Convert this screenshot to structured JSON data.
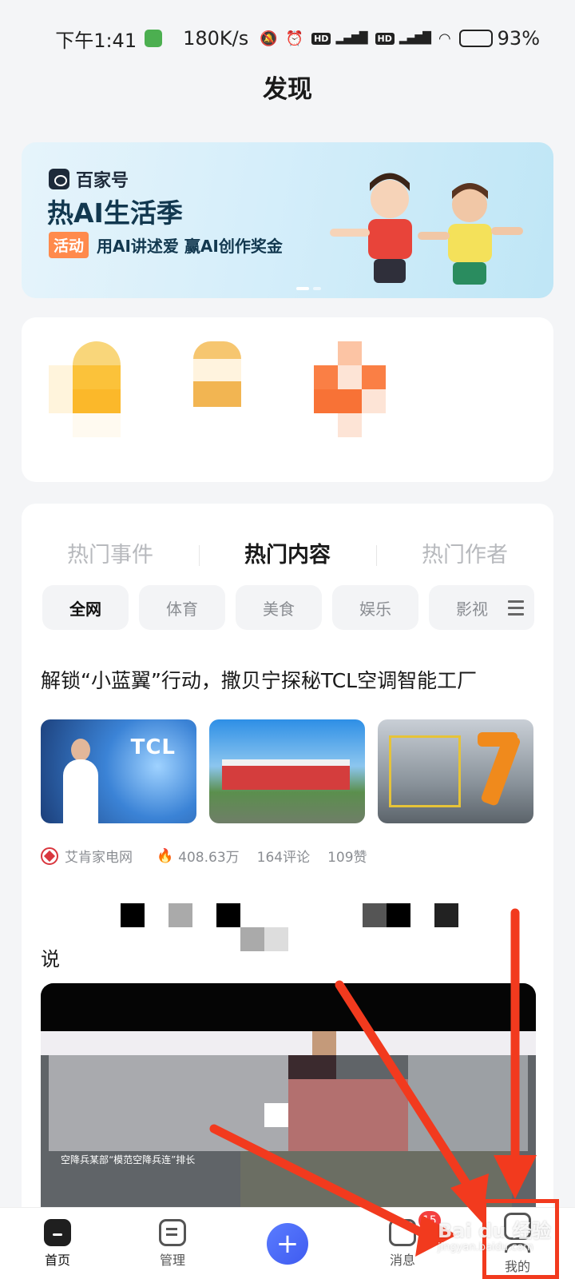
{
  "status_bar": {
    "time": "下午1:41",
    "net_speed": "180K/s",
    "sim1": "HD",
    "sim2": "HD",
    "net1": "5G",
    "net2": "5G",
    "battery_percent": "93%",
    "battery_level": 0.93
  },
  "page": {
    "title": "发现"
  },
  "banner": {
    "brand": "百家号",
    "headline": "热AI生活季",
    "tag": "活动",
    "subtitle": "用AI讲述爱 赢AI创作奖金"
  },
  "hot": {
    "tabs": [
      {
        "label": "热门事件",
        "active": false
      },
      {
        "label": "热门内容",
        "active": true
      },
      {
        "label": "热门作者",
        "active": false
      }
    ],
    "categories": [
      {
        "label": "全网",
        "active": true
      },
      {
        "label": "体育",
        "active": false
      },
      {
        "label": "美食",
        "active": false
      },
      {
        "label": "娱乐",
        "active": false
      },
      {
        "label": "影视",
        "active": false
      }
    ],
    "article": {
      "title": "解锁“小蓝翼”行动，撒贝宁探秘TCL空调智能工厂",
      "thumb1_text": "TCL",
      "source": "艾肯家电网",
      "views": "408.63万",
      "comments": "164评论",
      "likes": "109赞"
    },
    "article2": {
      "title_fragment": "说",
      "video_caption": "空降兵某部“模范空降兵连”排长"
    }
  },
  "bottom_nav": {
    "home": "首页",
    "manage": "管理",
    "publish": "+",
    "messages": "消息",
    "messages_badge": "15",
    "me": "我的"
  },
  "watermark": {
    "brand": "Bai du 经验",
    "url": "jingyan.baidu.com"
  },
  "colors": {
    "accent": "#3f5bf0",
    "annotation": "#f23a1e",
    "badge": "#f43f3f",
    "banner_tag": "#ff8a4c"
  }
}
